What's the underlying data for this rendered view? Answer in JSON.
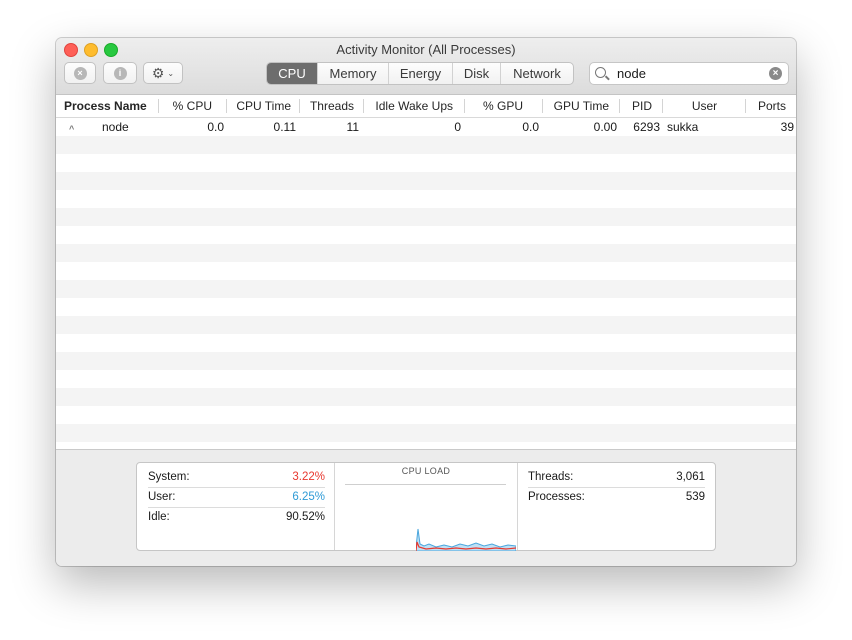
{
  "window": {
    "title": "Activity Monitor (All Processes)"
  },
  "toolbar": {
    "stop_icon": "x-circle-icon",
    "info_icon": "info-circle-icon",
    "gear_icon": "gear-icon",
    "stop_glyph": "×",
    "info_glyph": "i",
    "gear_glyph": "⚙",
    "caret_glyph": "⌄"
  },
  "tabs": [
    {
      "label": "CPU",
      "active": true
    },
    {
      "label": "Memory",
      "active": false
    },
    {
      "label": "Energy",
      "active": false
    },
    {
      "label": "Disk",
      "active": false
    },
    {
      "label": "Network",
      "active": false
    }
  ],
  "search": {
    "value": "node",
    "clear_glyph": "×"
  },
  "columns": {
    "process_name": "Process Name",
    "sort_glyph": "^",
    "cpu": "% CPU",
    "cpu_time": "CPU Time",
    "threads": "Threads",
    "idle_wake_ups": "Idle Wake Ups",
    "gpu": "% GPU",
    "gpu_time": "GPU Time",
    "pid": "PID",
    "user": "User",
    "ports": "Ports"
  },
  "processes": [
    {
      "process_name": "node",
      "cpu": "0.0",
      "cpu_time": "0.11",
      "threads": "11",
      "idle_wake_ups": "0",
      "gpu": "0.0",
      "gpu_time": "0.00",
      "pid": "6293",
      "user": "sukka",
      "ports": "39"
    }
  ],
  "summary": {
    "system_label": "System:",
    "system_value": "3.22%",
    "system_color": "#e8382f",
    "user_label": "User:",
    "user_value": "6.25%",
    "user_color": "#2f9bd6",
    "idle_label": "Idle:",
    "idle_value": "90.52%",
    "cpu_load_title": "CPU LOAD",
    "threads_label": "Threads:",
    "threads_value": "3,061",
    "processes_label": "Processes:",
    "processes_value": "539"
  }
}
